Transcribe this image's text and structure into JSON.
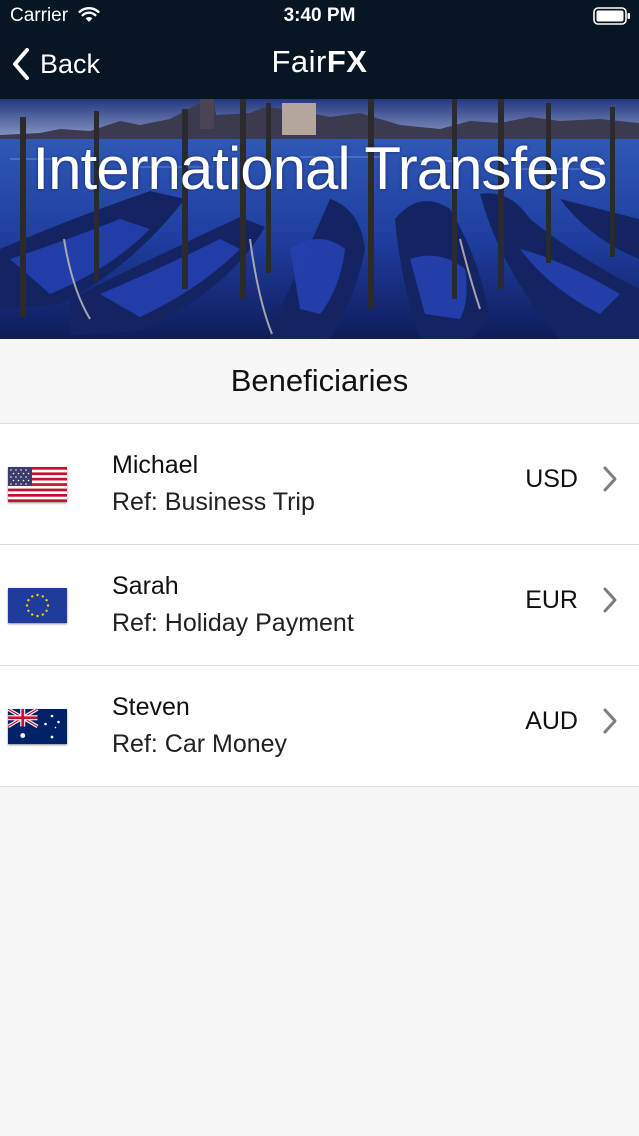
{
  "status_bar": {
    "carrier": "Carrier",
    "time": "3:40 PM"
  },
  "nav": {
    "back_label": "Back",
    "brand_part1": "Fair",
    "brand_part2": "FX"
  },
  "hero": {
    "title": "International Transfers"
  },
  "section": {
    "title": "Beneficiaries"
  },
  "beneficiaries": [
    {
      "name": "Michael",
      "reference": "Ref: Business Trip",
      "currency": "USD",
      "flag_icon": "us-flag-icon"
    },
    {
      "name": "Sarah",
      "reference": "Ref: Holiday Payment",
      "currency": "EUR",
      "flag_icon": "eu-flag-icon"
    },
    {
      "name": "Steven",
      "reference": "Ref: Car Money",
      "currency": "AUD",
      "flag_icon": "au-flag-icon"
    }
  ],
  "colors": {
    "nav_background": "#071622",
    "list_background": "#f6f6f7",
    "chevron": "#7d7d7d"
  }
}
